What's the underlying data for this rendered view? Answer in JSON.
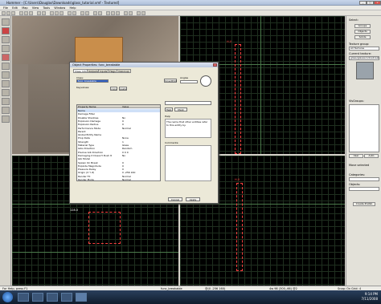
{
  "window": {
    "title": "Hammer - [C:\\Users\\Douglas\\Downloads\\glass_tutorial.vmf - Textured]"
  },
  "menu": [
    "File",
    "Edit",
    "Map",
    "View",
    "Tools",
    "Window",
    "Help"
  ],
  "rightpanel": {
    "select_label": "Select:",
    "groups": "Groups",
    "objects": "Objects",
    "solids": "Solids",
    "texture_group_label": "Texture group:",
    "texture_group": "All Textures",
    "current_texture_label": "Current texture:",
    "current_texture": "glass/glasswindowbreak",
    "visgroups_label": "VisGroups:",
    "user": "User",
    "auto": "Auto",
    "move_selected_label": "Move selected",
    "categories_label": "Categories:",
    "objects_label": "Objects:",
    "create_prefab": "Create Prefab"
  },
  "dialog": {
    "title": "Object Properties: func_breakable",
    "tabs": [
      "Class Info",
      "Outputs",
      "Inputs",
      "Flags",
      "VisGroup"
    ],
    "class_label": "Class:",
    "class_value": "func_breakable",
    "keyvalues_label": "Keyvalues:",
    "help_label": "Help",
    "smartedit_label": "SmartEdit",
    "angles_label": "Angles",
    "copy_label": "copy",
    "paste_label": "paste",
    "col_name": "Property Name",
    "col_value": "Value",
    "properties": [
      {
        "k": "Name",
        "v": ""
      },
      {
        "k": "Damage Filter",
        "v": ""
      },
      {
        "k": "Disable Shadows",
        "v": "No"
      },
      {
        "k": "Explosion Damage",
        "v": "0"
      },
      {
        "k": "Explosion Radius",
        "v": "0"
      },
      {
        "k": "Performance Mode",
        "v": "Normal"
      },
      {
        "k": "Parent",
        "v": ""
      },
      {
        "k": "Global Entity Name",
        "v": ""
      },
      {
        "k": "Prop Data",
        "v": "None"
      },
      {
        "k": "Strength",
        "v": "1"
      },
      {
        "k": "Material Type",
        "v": "Glass"
      },
      {
        "k": "Gibs Direction",
        "v": "Random"
      },
      {
        "k": "Precise Gib Direction",
        "v": "0 0 0"
      },
      {
        "k": "Damaging it Doesn't Push It",
        "v": "No"
      },
      {
        "k": "Gib Model",
        "v": ""
      },
      {
        "k": "Spawn On Break",
        "v": "0"
      },
      {
        "k": "Explode Magnitude",
        "v": "0"
      },
      {
        "k": "Pressure Delay",
        "v": "0"
      },
      {
        "k": "Origin (X Y Z)",
        "v": "0 -256 160"
      },
      {
        "k": "Render FX",
        "v": "Normal"
      },
      {
        "k": "Render Mode",
        "v": "Normal"
      }
    ],
    "help_text": "The name that other entities refer to this entity by.",
    "comments_label": "Comments:",
    "cancel": "Cancel",
    "apply": "Apply"
  },
  "viewports": {
    "label_top": "H-0",
    "label_side": "128.0",
    "label_front": "H-0"
  },
  "status": {
    "left": "For Help, press F1",
    "middle": "func_breakable",
    "coords": "@(0 -256 160)",
    "pos": "4w 98 (300,-66) @2",
    "snap": "Snap: On Grid: 4"
  },
  "taskbar": {
    "time": "9:14 PM",
    "date": "7/11/2008"
  },
  "colors": {
    "accent": "#bac8de",
    "grid_bg": "#000000",
    "selection": "#ff4040"
  }
}
